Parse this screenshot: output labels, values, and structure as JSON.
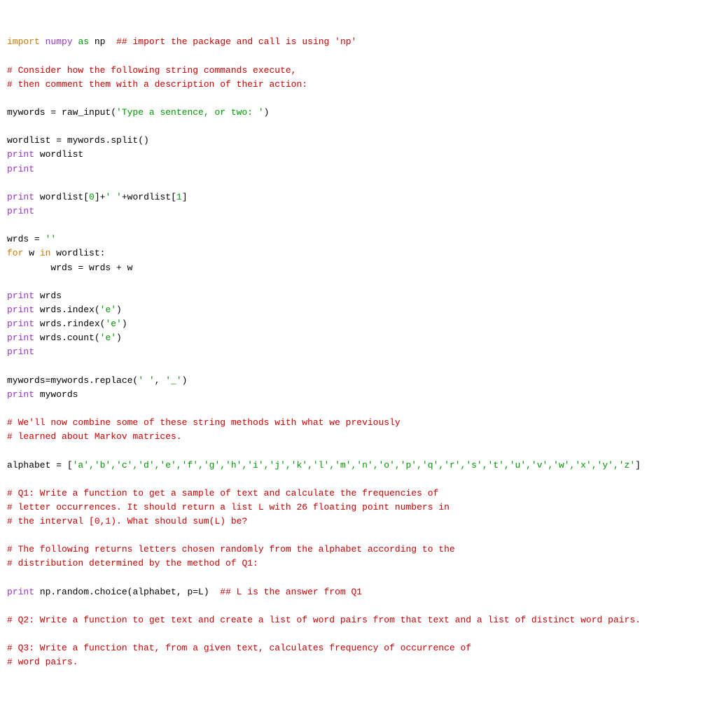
{
  "lines": {
    "l1_import": "import",
    "l1_numpy": "numpy",
    "l1_as": "as",
    "l1_np": "np",
    "l1_comment": "## import the package and call is using 'np'",
    "l2_comment": "# Consider how the following string commands execute,",
    "l3_comment": "# then comment them with a description of their action:",
    "l4_mywords": "mywords = raw_input(",
    "l4_str": "'Type a sentence, or two: '",
    "l4_close": ")",
    "l5_line": "wordlist = mywords.split()",
    "l6_print": "print",
    "l6_rest": " wordlist",
    "l7_print": "print",
    "l8_print": "print",
    "l8_rest_a": " wordlist[",
    "l8_zero": "0",
    "l8_rest_b": "]+",
    "l8_str": "' '",
    "l8_rest_c": "+wordlist[",
    "l8_one": "1",
    "l8_rest_d": "]",
    "l9_print": "print",
    "l10_assign": "wrds = ",
    "l10_str": "''",
    "l11_for": "for",
    "l11_w": " w ",
    "l11_in": "in",
    "l11_rest": " wordlist:",
    "l12_body": "        wrds = wrds + w",
    "l13_print": "print",
    "l13_rest": " wrds",
    "l14_print": "print",
    "l14_rest": " wrds.index(",
    "l14_str": "'e'",
    "l14_close": ")",
    "l15_print": "print",
    "l15_rest": " wrds.rindex(",
    "l15_str": "'e'",
    "l15_close": ")",
    "l16_print": "print",
    "l16_rest": " wrds.count(",
    "l16_str": "'e'",
    "l16_close": ")",
    "l17_print": "print",
    "l18_line_a": "mywords=mywords.replace(",
    "l18_str1": "' '",
    "l18_comma": ", ",
    "l18_str2": "'_'",
    "l18_close": ")",
    "l19_print": "print",
    "l19_rest": " mywords",
    "l20_comment": "# We'll now combine some of these string methods with what we previously",
    "l21_comment": "# learned about Markov matrices.",
    "l22_assign": "alphabet = [",
    "l22_letters": "'a','b','c','d','e','f','g','h','i','j','k','l','m','n','o','p','q','r','s','t','u','v','w','x','y','z'",
    "l22_close": "]",
    "l23_comment": "# Q1: Write a function to get a sample of text and calculate the frequencies of",
    "l24_comment": "# letter occurrences. It should return a list L with 26 floating point numbers in",
    "l25_comment": "# the interval [0,1). What should sum(L) be?",
    "l26_comment": "# The following returns letters chosen randomly from the alphabet according to the",
    "l27_comment": "# distribution determined by the method of Q1:",
    "l28_print": "print",
    "l28_rest": " np.random.choice(alphabet, p=L)  ",
    "l28_comment": "## L is the answer from Q1",
    "l29_comment": "# Q2: Write a function to get text and create a list of word pairs from that text and a list of distinct word pairs.",
    "l30_comment": "# Q3: Write a function that, from a given text, calculates frequency of occurrence of",
    "l31_comment": "# word pairs."
  }
}
